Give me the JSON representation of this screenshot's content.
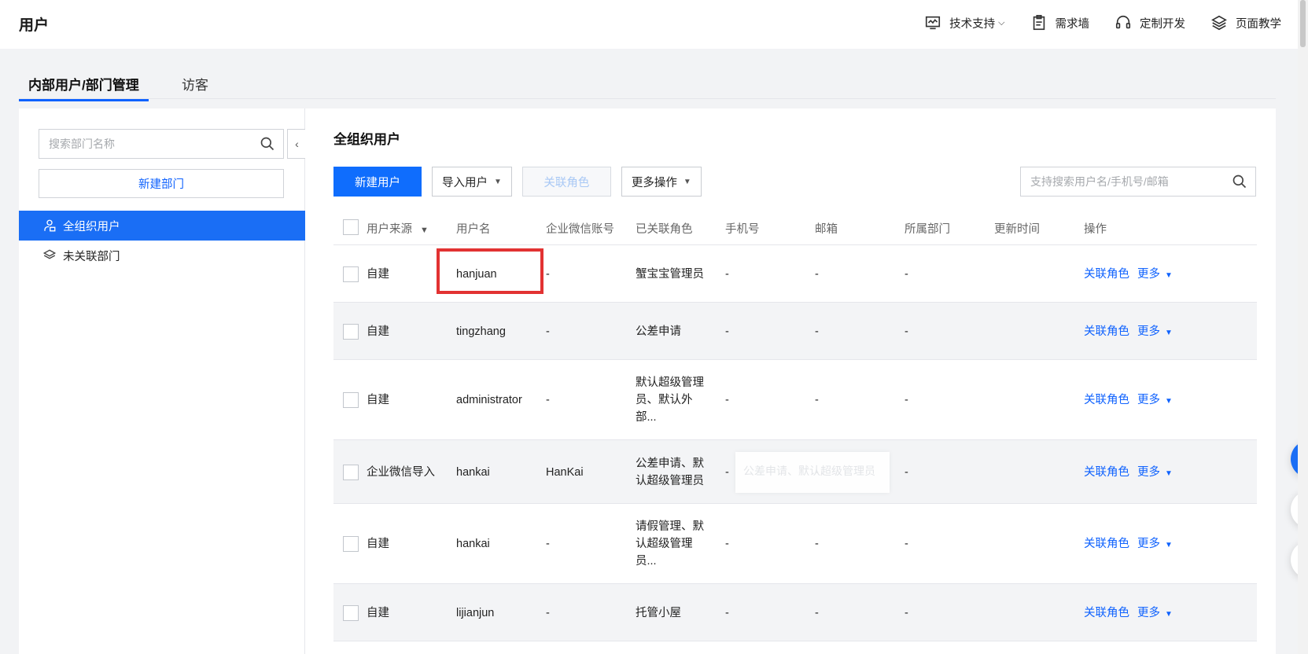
{
  "header": {
    "title": "用户",
    "nav": [
      {
        "label": "技术支持",
        "icon": "monitor-icon",
        "caret": "⌵"
      },
      {
        "label": "需求墙",
        "icon": "clipboard-icon"
      },
      {
        "label": "定制开发",
        "icon": "headset-icon"
      },
      {
        "label": "页面教学",
        "icon": "layers-icon"
      }
    ]
  },
  "tabs": {
    "active": "内部用户/部门管理",
    "inactive": "访客"
  },
  "sidebar": {
    "search_placeholder": "搜索部门名称",
    "new_dept_label": "新建部门",
    "collapse_glyph": "‹",
    "items": [
      {
        "label": "全组织用户",
        "icon": "org-user-icon",
        "selected": true
      },
      {
        "label": "未关联部门",
        "icon": "layers-icon",
        "selected": false
      }
    ]
  },
  "main": {
    "title": "全组织用户",
    "toolbar": {
      "new_user": "新建用户",
      "import_user": "导入用户",
      "link_role": "关联角色",
      "more_actions": "更多操作"
    },
    "search_placeholder": "支持搜索用户名/手机号/邮箱",
    "columns": [
      "用户来源",
      "用户名",
      "企业微信账号",
      "已关联角色",
      "手机号",
      "邮箱",
      "所属部门",
      "更新时间",
      "操作"
    ],
    "filter_glyph": "▼",
    "rows": [
      {
        "source": "自建",
        "username": "hanjuan",
        "wecom": "-",
        "roles": [
          "蟹宝宝管理员"
        ],
        "phone": "-",
        "email": "-",
        "dept": "-",
        "updated": "",
        "action_link": "关联角色",
        "action_more": "更多"
      },
      {
        "source": "自建",
        "username": "tingzhang",
        "wecom": "-",
        "roles": [
          "公差申请"
        ],
        "phone": "-",
        "email": "-",
        "dept": "-",
        "updated": "",
        "action_link": "关联角色",
        "action_more": "更多"
      },
      {
        "source": "自建",
        "username": "administrator",
        "wecom": "-",
        "roles": [
          "默认超级管理",
          "员、默认外",
          "部..."
        ],
        "phone": "-",
        "email": "-",
        "dept": "-",
        "updated": "",
        "action_link": "关联角色",
        "action_more": "更多"
      },
      {
        "source": "企业微信导入",
        "username": "hankai",
        "wecom": "HanKai",
        "roles": [
          "公差申请、默",
          "认超级管理员"
        ],
        "phone": "-",
        "email": "-",
        "dept": "-",
        "updated": "",
        "action_link": "关联角色",
        "action_more": "更多"
      },
      {
        "source": "自建",
        "username": "hankai",
        "wecom": "-",
        "roles": [
          "请假管理、默",
          "认超级管理",
          "员..."
        ],
        "phone": "-",
        "email": "-",
        "dept": "-",
        "updated": "",
        "action_link": "关联角色",
        "action_more": "更多"
      },
      {
        "source": "自建",
        "username": "lijianjun",
        "wecom": "-",
        "roles": [
          "托管小屋"
        ],
        "phone": "-",
        "email": "-",
        "dept": "-",
        "updated": "",
        "action_link": "关联角色",
        "action_more": "更多"
      }
    ],
    "tooltip_text": "公差申请、默认超级管理员"
  },
  "floating": [
    "customer-service-icon",
    "book-icon",
    "outline-icon"
  ],
  "colors": {
    "accent": "#0f62fe",
    "highlight": "#e23232",
    "selected_bg": "#1a6ef5"
  }
}
